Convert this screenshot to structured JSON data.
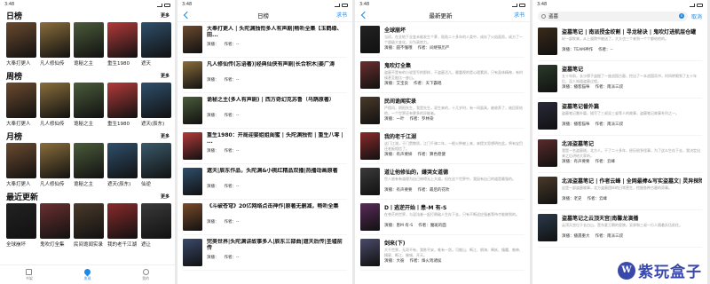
{
  "status": {
    "time": "3:48"
  },
  "home": {
    "sections": [
      {
        "title": "日榜",
        "more": "更多",
        "books": [
          {
            "name": "大奉打更人",
            "color": "#6b4a2f"
          },
          {
            "name": "凡人修仙传",
            "color": "#8a6d3b"
          },
          {
            "name": "诡秘之主",
            "color": "#4b5b3a"
          },
          {
            "name": "重生1980",
            "color": "#b33a3a"
          },
          {
            "name": "遮天",
            "color": "#2f4f6b"
          }
        ]
      },
      {
        "title": "周榜",
        "more": "更多",
        "books": [
          {
            "name": "大奉打更人",
            "color": "#6b4a2f"
          },
          {
            "name": "凡人修仙传",
            "color": "#8a6d3b"
          },
          {
            "name": "诡秘之主",
            "color": "#4b5b3a"
          },
          {
            "name": "重生1980",
            "color": "#b33a3a"
          },
          {
            "name": "遮天(辰东)",
            "color": "#2f4f6b"
          }
        ]
      },
      {
        "title": "月榜",
        "more": "更多",
        "books": [
          {
            "name": "大奉打更人",
            "color": "#6b4a2f"
          },
          {
            "name": "凡人修仙传",
            "color": "#8a6d3b"
          },
          {
            "name": "诡秘之主",
            "color": "#4b5b3a"
          },
          {
            "name": "遮天(辰东)",
            "color": "#2f4f6b"
          },
          {
            "name": "仙逆",
            "color": "#3a5a6b"
          }
        ]
      },
      {
        "title": "最近更新",
        "more": "更多",
        "books": [
          {
            "name": "全球崩坏",
            "color": "#222222"
          },
          {
            "name": "鬼吹灯全集",
            "color": "#6b2f2f"
          },
          {
            "name": "民间诡闻实录",
            "color": "#4a3a2a"
          },
          {
            "name": "我的老千江湖",
            "color": "#8a2a2a"
          },
          {
            "name": "遮让",
            "color": "#3a3a3a"
          }
        ]
      }
    ],
    "tabs": [
      {
        "label": "书架",
        "icon": "bookshelf-icon"
      },
      {
        "label": "发现",
        "icon": "flame-icon"
      },
      {
        "label": "我的",
        "icon": "user-icon"
      }
    ]
  },
  "daily": {
    "back_icon": "back-arrow-icon",
    "title": "日榜",
    "right": "求书",
    "items": [
      {
        "title": "大奉打更人 | 头陀渊独衔多人有声剧|畅听全集【玉鹤缘、田...",
        "narrator": "演播：",
        "author": "作者：--",
        "color": "#6b4a2f"
      },
      {
        "title": "凡人修仙传(忘语著)|经典仙侠有声剧|长合积木|姜广涛",
        "narrator": "演播：",
        "author": "作者：--",
        "color": "#8a6d3b"
      },
      {
        "title": "诡秘之主(多人有声剧) | 西方奇幻克苏鲁（乌鹊原著）",
        "narrator": "演播：",
        "author": "作者：--",
        "color": "#4b5b3a"
      },
      {
        "title": "重生1980：开局迎娶姐姐闺蜜 | 头陀渊独衔 | 重生八零 | ...",
        "narrator": "演播：",
        "author": "作者：--",
        "color": "#b33a3a"
      },
      {
        "title": "遮天|辰东作品，头陀渊&小桃红精品双播|热播动画原著",
        "narrator": "演播：",
        "author": "作者：--",
        "color": "#2f4f6b"
      },
      {
        "title": "《斗破苍穹》20亿网络点击神作|原著无删减，畅听全集",
        "narrator": "演播：",
        "author": "作者：--",
        "color": "#7a4a2a"
      },
      {
        "title": "完美世界|头陀渊讲故事多人|辰东三部曲|遮天后传|圣墟前传",
        "narrator": "演播：",
        "author": "作者：--",
        "color": "#3a4a6b"
      }
    ]
  },
  "latest": {
    "back_icon": "back-arrow-icon",
    "title": "最新更新",
    "right": "求书",
    "items": [
      {
        "title": "全球崩坏",
        "desc": "当初，在全地下全变未能发生个萝，陆陆二十多年的人类中，成存了火焰面男，成方了一个超级大变化，分为高势力。",
        "narrator": "演播：圆不懂哦",
        "author": "作者：间继铁历严",
        "color": "#222222"
      },
      {
        "title": "鬼吹灯全集",
        "desc": "盗墓不是有的小说里写的那样，干盗墓活儿，最重视的是心理素质，只有身体精神，有时候甚至能比一座山。",
        "narrator": "演播：艾宝良",
        "author": "作者：天下霸唱",
        "color": "#6b2f2f"
      },
      {
        "title": "民间诡闻实录",
        "desc": "严宿问，阴阳先生，我是先生，双生来的，十几岁时，有一间面具，被收养了，她回家给他，一个世界还有更多的异能者。",
        "narrator": "演播：一叶",
        "author": "作者：罗林染",
        "color": "#4a3a2a"
      },
      {
        "title": "我的老千江湖",
        "desc": "这门江湖，于门贯教质，江门千骑二年，一根火种被上来，来提文思想明在此。将有宝目还老板相信了。",
        "narrator": "演播：有声要妍",
        "author": "作者：算色稳健",
        "color": "#8a2a2a"
      },
      {
        "title": "道让他修仙的，嫌哭女道德",
        "desc": "世人皆有有道理为自己修得无上大道，但在这个世界中，我因有自己的道是最强的。",
        "narrator": "演播：有声要要",
        "author": "作者：最后的花吹",
        "color": "#3a3a3a"
      },
      {
        "title": "D丨逃逆开始丨患-M 有-S",
        "desc": "在苍茫的世界，与混沌者一起打倒敌人生存下去，只有不断适应强者等待才能做到的。",
        "narrator": "演播：患M 有-S",
        "author": "作者：魔斑的面",
        "color": "#5a2a5a"
      },
      {
        "title": "剑来(下)",
        "desc": "大千世界，无奇不有，我陈平安，唯有一剑，可搬山、断江、倒海、降妖、镇魔、敕神、摘星、断江、摧城、开天。",
        "narrator": "演播：大彼",
        "author": "作者：烽火戏诸侯",
        "color": "#4a4a6b"
      }
    ]
  },
  "search": {
    "value": "盗墓",
    "cancel": "取消",
    "items": [
      {
        "title": "盗墓笔记 | 南派授金绞割 | 寻龙秘诀 | 鬼吹灯进航层仓罐",
        "desc": "好一部吹来，从上道院中被送了，大大也三个来到一个个都给他的。",
        "narrator": "演播：TEAM神作",
        "author": "作者：--",
        "color": "#3a2a1a"
      },
      {
        "title": "盗墓笔记",
        "desc": "五十年前，长沙镖子盗掘了一座战国古墓，挖出了一本战国帛书，时间转眼到了五十年后，没人知道盗墓过程。",
        "narrator": "演播：播客猫咪",
        "author": "作者：南派三叔",
        "color": "#2a3a2a"
      },
      {
        "title": "盗墓笔记番外篇",
        "desc": "盗墓笔记番外篇，描写了三叔吴三省等人的故事，盗墓笔记故事系列之一。",
        "narrator": "演播：播客猫咪",
        "author": "作者：南派三叔",
        "color": "#2a2a3a"
      },
      {
        "title": "北派盗墓笔记",
        "desc": "我是一名盗墓贼，北方人。干了二十多年，经历很多怪事，为了这么生存下去，我决定出来之后讲给大家听。",
        "narrator": "演播：有声要要",
        "author": "作者：云峰",
        "color": "#5a2a2a"
      },
      {
        "title": "北派盗墓笔记 | 作者云峰 | 全网最棒&写实盗墓文| 灵异探险...",
        "desc": "这是一部盗墓故事，北方盗墓团伙的日常营生，挖掘各种古墓的奇事。",
        "narrator": "演播：老史",
        "author": "作者：云峰",
        "color": "#4a3a2a"
      },
      {
        "title": "盗墓笔记之云顶天宫|南馨龙演播",
        "desc": "云顶天宫位于长白山，是东夏王朝的皇陵。吴邪和三叔一行人随着队伍前往。",
        "narrator": "演播：播遇重大",
        "author": "作者：南派三叔",
        "color": "#2a3a4a"
      }
    ]
  },
  "watermark": {
    "logo": "W",
    "text": "紫玩盒子"
  }
}
